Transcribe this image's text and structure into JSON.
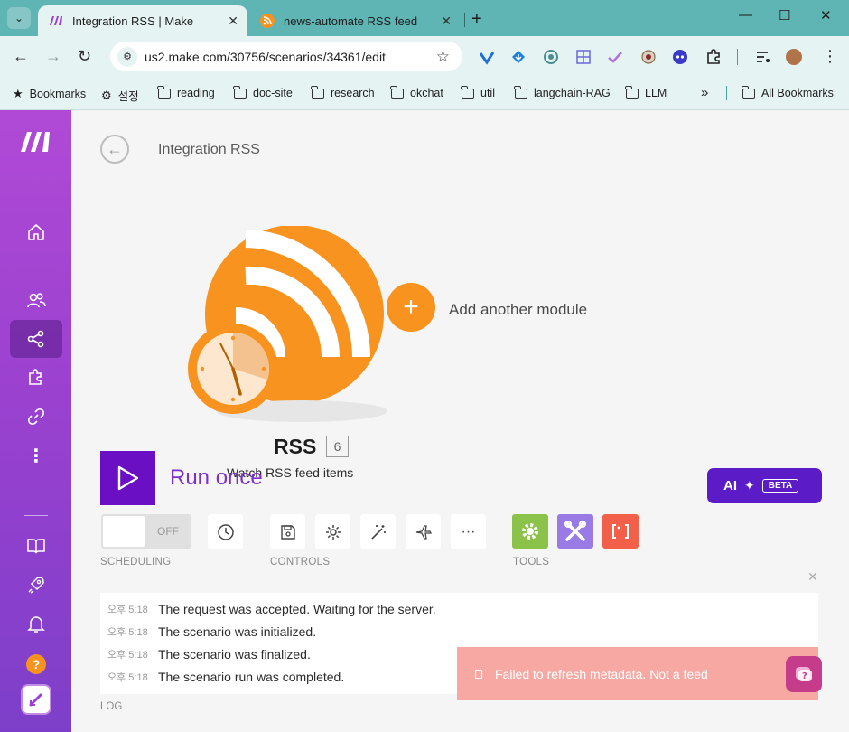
{
  "browser": {
    "tabs": [
      {
        "title": "Integration RSS | Make",
        "active": true
      },
      {
        "title": "news-automate RSS feed",
        "active": false
      }
    ],
    "url": "us2.make.com/30756/scenarios/34361/edit",
    "bookmarks": [
      "Bookmarks",
      "설정",
      "reading",
      "doc-site",
      "research",
      "okchat",
      "util",
      "langchain-RAG",
      "LLM"
    ],
    "overflow": "»",
    "all_bookmarks": "All Bookmarks"
  },
  "sidebar": {
    "items": [
      "home-icon",
      "team-icon",
      "scenarios-icon",
      "apps-icon",
      "connections-icon",
      "more-icon"
    ],
    "bottom": [
      "docs-icon",
      "whats-new-icon",
      "notifications-icon",
      "help-icon",
      "user-icon"
    ],
    "help_glyph": "?"
  },
  "scenario": {
    "title": "Integration RSS",
    "add_module_label": "Add another module",
    "module": {
      "name": "RSS",
      "badge": "6",
      "description": "Watch RSS feed items"
    }
  },
  "controls": {
    "run_label": "Run once",
    "ai_label": "AI",
    "ai_badge": "BETA",
    "scheduling_state": "OFF",
    "scheduling_label": "SCHEDULING",
    "controls_label": "CONTROLS",
    "tools_label": "TOOLS",
    "more_glyph": "···"
  },
  "log": {
    "label": "LOG",
    "entries": [
      {
        "time": "오후 5:18",
        "message": "The request was accepted. Waiting for the server."
      },
      {
        "time": "오후 5:18",
        "message": "The scenario was initialized."
      },
      {
        "time": "오후 5:18",
        "message": "The scenario was finalized."
      },
      {
        "time": "오후 5:18",
        "message": "The scenario run was completed."
      }
    ]
  },
  "toast": {
    "message": "Failed to refresh metadata. Not a feed",
    "close": "×"
  },
  "colors": {
    "brand_purple": "#6a0fc4",
    "rss_orange": "#f7931e",
    "tools_green": "#8bc34a",
    "tools_violet": "#9a7be6",
    "tools_red": "#f2604a",
    "toast_bg": "#f7a8a3"
  }
}
